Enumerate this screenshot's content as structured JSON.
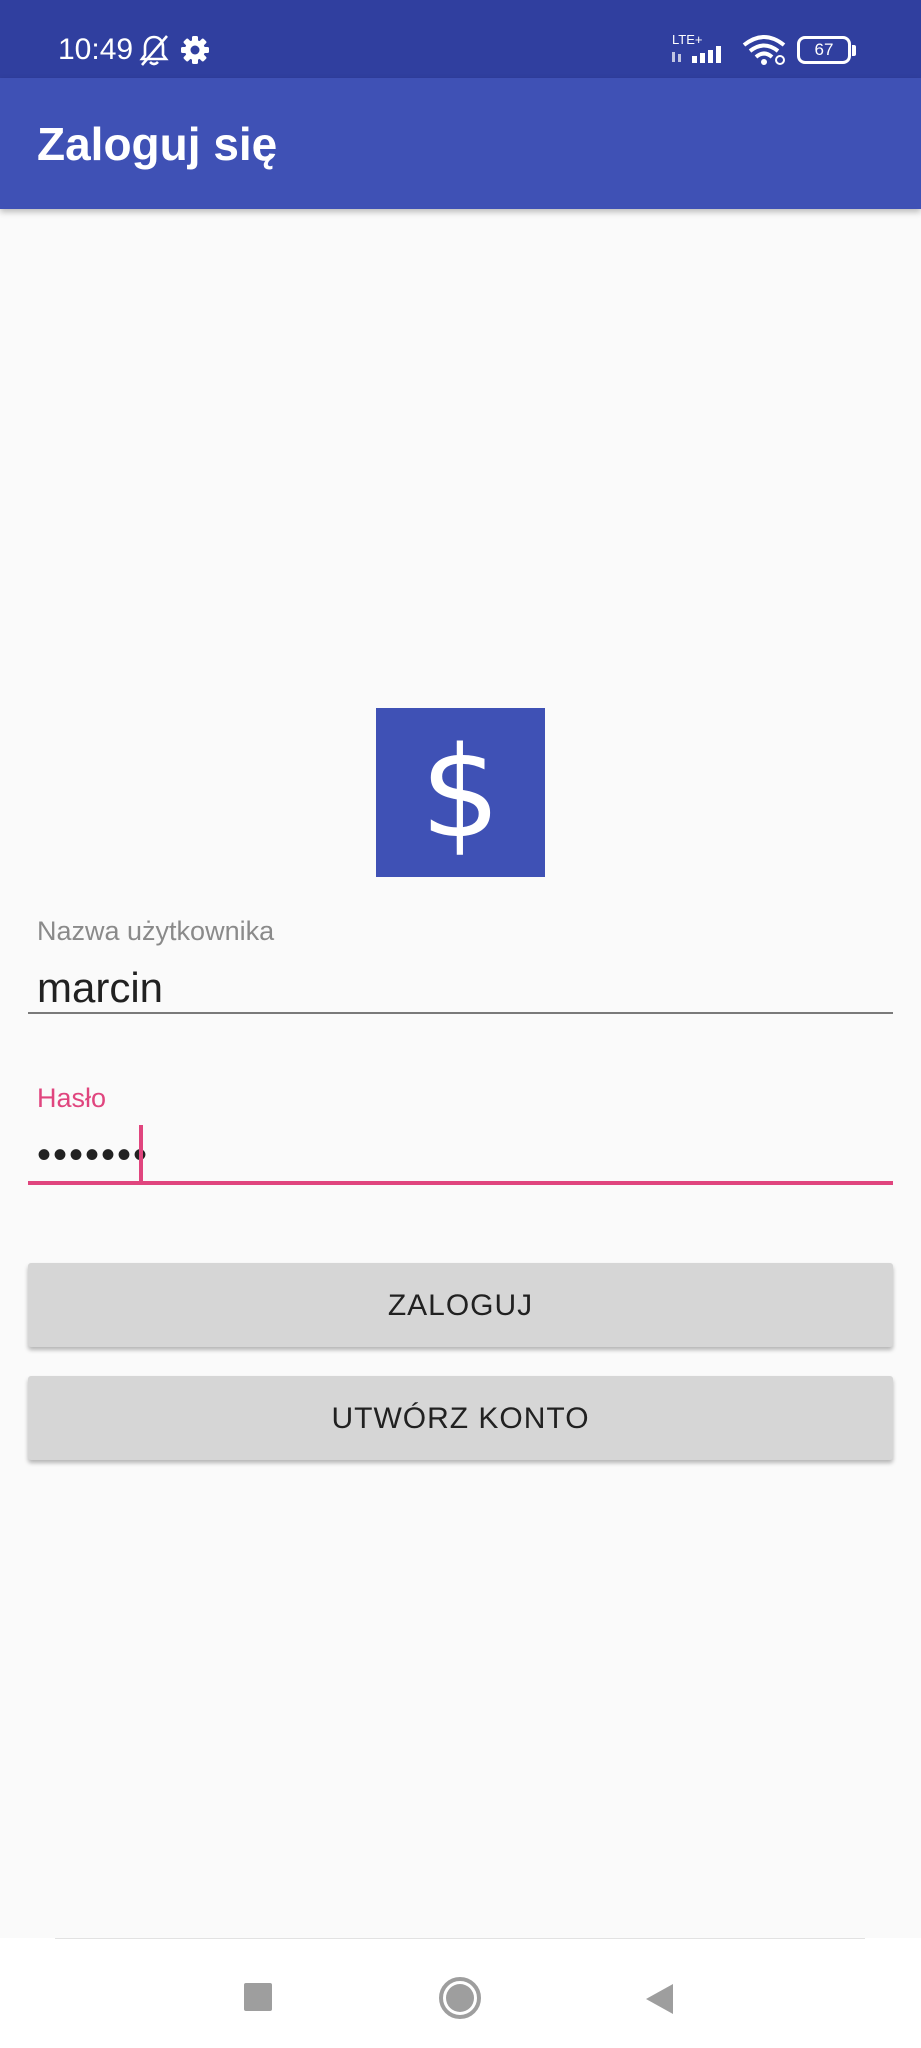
{
  "status_bar": {
    "time": "10:49",
    "network_label": "LTE+",
    "battery_level": "67",
    "icons": [
      "bell-off-icon",
      "gear-icon",
      "signal-icon",
      "wifi-icon",
      "battery-icon"
    ]
  },
  "app_bar": {
    "title": "Zaloguj się"
  },
  "logo": {
    "glyph": "$",
    "icon": "dollar-icon"
  },
  "form": {
    "username": {
      "label": "Nazwa użytkownika",
      "value": "marcin"
    },
    "password": {
      "label": "Hasło",
      "value": "•••••••"
    }
  },
  "buttons": {
    "login_label": "ZALOGUJ",
    "create_account_label": "UTWÓRZ KONTO"
  },
  "nav_bar": {
    "icons": [
      "recents-icon",
      "home-icon",
      "back-icon"
    ]
  },
  "colors": {
    "status_bar": "#303f9f",
    "primary": "#3f51b5",
    "accent": "#e0457e",
    "button": "#d6d6d6",
    "background": "#fafafa"
  }
}
